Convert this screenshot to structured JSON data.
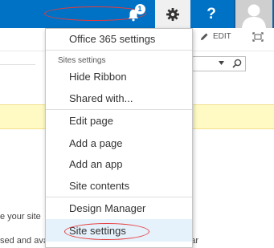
{
  "topbar": {
    "notification_count": "1",
    "help_label": "?",
    "bell_icon": "bell-icon",
    "gear_icon": "gear-icon",
    "avatar_icon": "person-icon",
    "accent": "#0072c6"
  },
  "ribbon": {
    "edit_label": "EDIT"
  },
  "background": {
    "text1": "e your site",
    "text2": "sed and available for uploaded images that appear"
  },
  "menu": {
    "office365": "Office 365 settings",
    "section_label": "Sites settings",
    "hide_ribbon": "Hide Ribbon",
    "shared_with": "Shared with...",
    "edit_page": "Edit page",
    "add_page": "Add a page",
    "add_app": "Add an app",
    "site_contents": "Site contents",
    "design_manager": "Design Manager",
    "site_settings": "Site settings"
  }
}
